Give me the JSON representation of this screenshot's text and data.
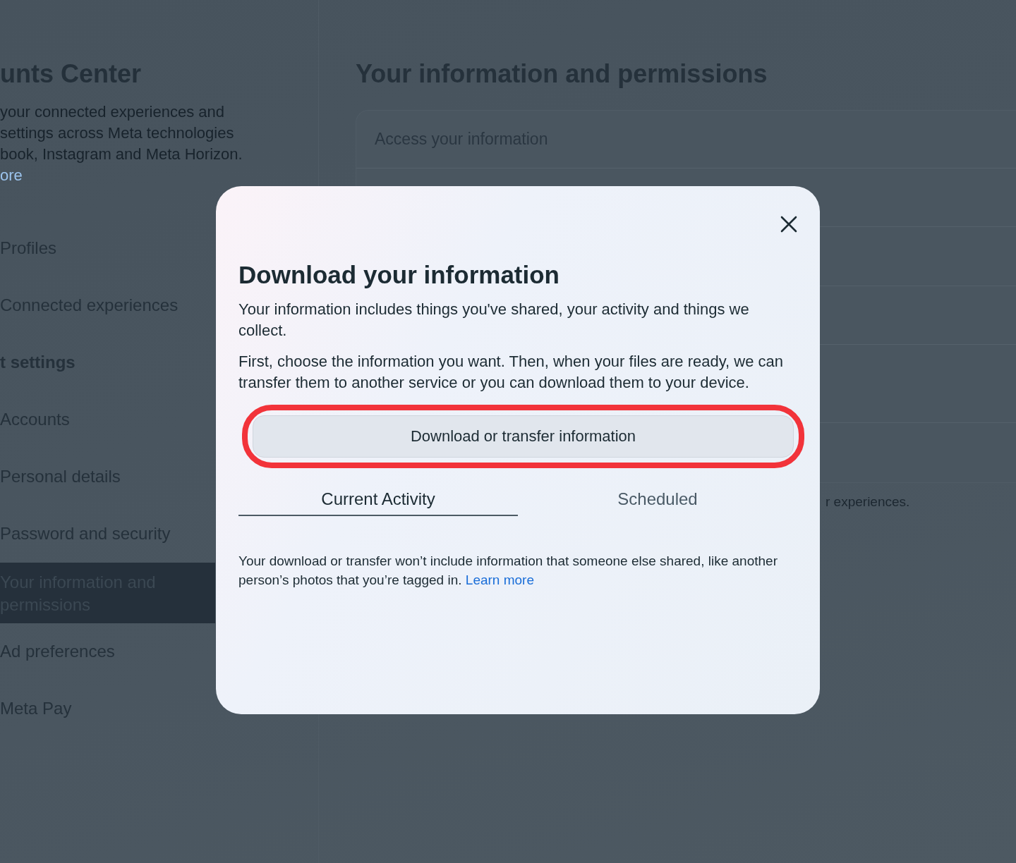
{
  "sidebar": {
    "title": "unts Center",
    "description": [
      "your connected experiences and",
      "settings across Meta technologies",
      "book, Instagram and Meta Horizon."
    ],
    "link": "ore",
    "items": [
      {
        "label": "Profiles",
        "kind": "item",
        "selected": false
      },
      {
        "label": "Connected experiences",
        "kind": "item",
        "selected": false
      },
      {
        "label": "t settings",
        "kind": "header",
        "selected": false
      },
      {
        "label": "Accounts",
        "kind": "item",
        "selected": false
      },
      {
        "label": "Personal details",
        "kind": "item",
        "selected": false
      },
      {
        "label": "Password and security",
        "kind": "item",
        "selected": false
      },
      {
        "label": "Your information and permissions",
        "kind": "item",
        "selected": true
      },
      {
        "label": "Ad preferences",
        "kind": "item",
        "selected": false
      },
      {
        "label": "Meta Pay",
        "kind": "item",
        "selected": false
      }
    ]
  },
  "main": {
    "title": "Your information and permissions",
    "first_row": "Access your information",
    "note": "r experiences."
  },
  "dialog": {
    "title": "Download your information",
    "paragraphs": [
      "Your information includes things you've shared, your activity and things we collect.",
      "First, choose the information you want. Then, when your files are ready, we can transfer them to another service or you can download them to your device."
    ],
    "button": {
      "label": "Download or transfer information",
      "highlighted": true
    },
    "tabs": [
      {
        "label": "Current Activity",
        "selected": true
      },
      {
        "label": "Scheduled",
        "selected": false
      }
    ],
    "footnote": "Your download or transfer won’t include information that someone else shared, like another person’s photos that you’re tagged in.",
    "footnote_link": "Learn more"
  }
}
